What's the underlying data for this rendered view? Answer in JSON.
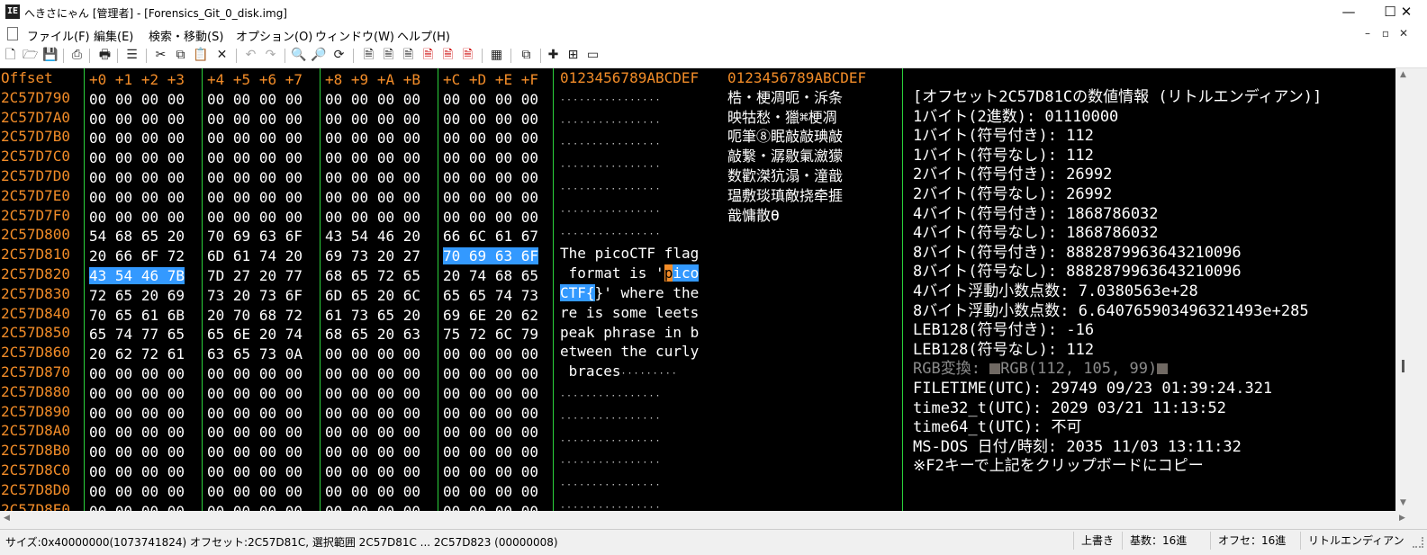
{
  "window": {
    "app_icon_text": "IE",
    "title": "へきさにゃん [管理者] - [Forensics_Git_0_disk.img]",
    "minimize": "—",
    "maximize": "☐",
    "close": "✕"
  },
  "menu": {
    "items": [
      "ファイル(F)",
      "編集(E)",
      "検索・移動(S)",
      "オプション(O)",
      "ウィンドウ(W)",
      "ヘルプ(H)"
    ],
    "mdi_buttons": [
      "–",
      "▫",
      "✕"
    ]
  },
  "toolbar": {
    "icons": [
      "new-file-icon",
      "open-folder-icon",
      "save-icon",
      "print-icon",
      "indent-icon",
      "cut-icon",
      "copy-icon",
      "paste-icon",
      "delete-icon",
      "undo-icon",
      "redo-icon",
      "page-1-icon",
      "page-2-icon",
      "page-3-icon",
      "page-4-icon",
      "page-5-icon",
      "page-6-icon",
      "char-code-icon",
      "window-icon",
      "search-icon",
      "search-next-icon",
      "replace-icon",
      "move-1-icon",
      "move-2-icon",
      "window-layout-icon"
    ]
  },
  "hex_view": {
    "offset_header": "Offset",
    "column_headers": [
      "+0",
      "+1",
      "+2",
      "+3",
      "+4",
      "+5",
      "+6",
      "+7",
      "+8",
      "+9",
      "+A",
      "+B",
      "+C",
      "+D",
      "+E",
      "+F"
    ],
    "ascii_header": "0123456789ABCDEF",
    "sjis_header": "0123456789ABCDEF",
    "rows": [
      {
        "offset": "2C57D790",
        "bytes": [
          "00",
          "00",
          "00",
          "00",
          "00",
          "00",
          "00",
          "00",
          "00",
          "00",
          "00",
          "00",
          "00",
          "00",
          "00",
          "00"
        ],
        "ascii": "................"
      },
      {
        "offset": "2C57D7A0",
        "bytes": [
          "00",
          "00",
          "00",
          "00",
          "00",
          "00",
          "00",
          "00",
          "00",
          "00",
          "00",
          "00",
          "00",
          "00",
          "00",
          "00"
        ],
        "ascii": "................"
      },
      {
        "offset": "2C57D7B0",
        "bytes": [
          "00",
          "00",
          "00",
          "00",
          "00",
          "00",
          "00",
          "00",
          "00",
          "00",
          "00",
          "00",
          "00",
          "00",
          "00",
          "00"
        ],
        "ascii": "................"
      },
      {
        "offset": "2C57D7C0",
        "bytes": [
          "00",
          "00",
          "00",
          "00",
          "00",
          "00",
          "00",
          "00",
          "00",
          "00",
          "00",
          "00",
          "00",
          "00",
          "00",
          "00"
        ],
        "ascii": "................"
      },
      {
        "offset": "2C57D7D0",
        "bytes": [
          "00",
          "00",
          "00",
          "00",
          "00",
          "00",
          "00",
          "00",
          "00",
          "00",
          "00",
          "00",
          "00",
          "00",
          "00",
          "00"
        ],
        "ascii": "................"
      },
      {
        "offset": "2C57D7E0",
        "bytes": [
          "00",
          "00",
          "00",
          "00",
          "00",
          "00",
          "00",
          "00",
          "00",
          "00",
          "00",
          "00",
          "00",
          "00",
          "00",
          "00"
        ],
        "ascii": "................"
      },
      {
        "offset": "2C57D7F0",
        "bytes": [
          "00",
          "00",
          "00",
          "00",
          "00",
          "00",
          "00",
          "00",
          "00",
          "00",
          "00",
          "00",
          "00",
          "00",
          "00",
          "00"
        ],
        "ascii": "................"
      },
      {
        "offset": "2C57D800",
        "bytes": [
          "54",
          "68",
          "65",
          "20",
          "70",
          "69",
          "63",
          "6F",
          "43",
          "54",
          "46",
          "20",
          "66",
          "6C",
          "61",
          "67"
        ],
        "ascii": "The picoCTF flag"
      },
      {
        "offset": "2C57D810",
        "bytes": [
          "20",
          "66",
          "6F",
          "72",
          "6D",
          "61",
          "74",
          "20",
          "69",
          "73",
          "20",
          "27",
          "70",
          "69",
          "63",
          "6F"
        ],
        "ascii": " format is 'pico"
      },
      {
        "offset": "2C57D820",
        "bytes": [
          "43",
          "54",
          "46",
          "7B",
          "7D",
          "27",
          "20",
          "77",
          "68",
          "65",
          "72",
          "65",
          "20",
          "74",
          "68",
          "65"
        ],
        "ascii": "CTF{}' where the"
      },
      {
        "offset": "2C57D830",
        "bytes": [
          "72",
          "65",
          "20",
          "69",
          "73",
          "20",
          "73",
          "6F",
          "6D",
          "65",
          "20",
          "6C",
          "65",
          "65",
          "74",
          "73"
        ],
        "ascii": "re is some leets"
      },
      {
        "offset": "2C57D840",
        "bytes": [
          "70",
          "65",
          "61",
          "6B",
          "20",
          "70",
          "68",
          "72",
          "61",
          "73",
          "65",
          "20",
          "69",
          "6E",
          "20",
          "62"
        ],
        "ascii": "peak phrase in b"
      },
      {
        "offset": "2C57D850",
        "bytes": [
          "65",
          "74",
          "77",
          "65",
          "65",
          "6E",
          "20",
          "74",
          "68",
          "65",
          "20",
          "63",
          "75",
          "72",
          "6C",
          "79"
        ],
        "ascii": "etween the curly"
      },
      {
        "offset": "2C57D860",
        "bytes": [
          "20",
          "62",
          "72",
          "61",
          "63",
          "65",
          "73",
          "0A",
          "00",
          "00",
          "00",
          "00",
          "00",
          "00",
          "00",
          "00"
        ],
        "ascii": " braces........."
      },
      {
        "offset": "2C57D870",
        "bytes": [
          "00",
          "00",
          "00",
          "00",
          "00",
          "00",
          "00",
          "00",
          "00",
          "00",
          "00",
          "00",
          "00",
          "00",
          "00",
          "00"
        ],
        "ascii": "................"
      },
      {
        "offset": "2C57D880",
        "bytes": [
          "00",
          "00",
          "00",
          "00",
          "00",
          "00",
          "00",
          "00",
          "00",
          "00",
          "00",
          "00",
          "00",
          "00",
          "00",
          "00"
        ],
        "ascii": "................"
      },
      {
        "offset": "2C57D890",
        "bytes": [
          "00",
          "00",
          "00",
          "00",
          "00",
          "00",
          "00",
          "00",
          "00",
          "00",
          "00",
          "00",
          "00",
          "00",
          "00",
          "00"
        ],
        "ascii": "................"
      },
      {
        "offset": "2C57D8A0",
        "bytes": [
          "00",
          "00",
          "00",
          "00",
          "00",
          "00",
          "00",
          "00",
          "00",
          "00",
          "00",
          "00",
          "00",
          "00",
          "00",
          "00"
        ],
        "ascii": "................"
      },
      {
        "offset": "2C57D8B0",
        "bytes": [
          "00",
          "00",
          "00",
          "00",
          "00",
          "00",
          "00",
          "00",
          "00",
          "00",
          "00",
          "00",
          "00",
          "00",
          "00",
          "00"
        ],
        "ascii": "................"
      },
      {
        "offset": "2C57D8C0",
        "bytes": [
          "00",
          "00",
          "00",
          "00",
          "00",
          "00",
          "00",
          "00",
          "00",
          "00",
          "00",
          "00",
          "00",
          "00",
          "00",
          "00"
        ],
        "ascii": "................"
      },
      {
        "offset": "2C57D8D0",
        "bytes": [
          "00",
          "00",
          "00",
          "00",
          "00",
          "00",
          "00",
          "00",
          "00",
          "00",
          "00",
          "00",
          "00",
          "00",
          "00",
          "00"
        ],
        "ascii": "................"
      },
      {
        "offset": "2C57D8E0",
        "bytes": [
          "00",
          "00",
          "00",
          "00",
          "00",
          "00",
          "00",
          "00",
          "00",
          "00",
          "00",
          "00",
          "00",
          "00",
          "00",
          "00"
        ],
        "ascii": "................"
      }
    ],
    "sjis_rows": {
      "7": "梏・梗凋呃・泝条",
      "8": "映牯愁・獵⌘梗凋",
      "9": "呃筆⑧眠敲敲琠敲",
      "10": "敲繋・潺敭氭瀲獴",
      "11": "数歡滐犺溻・潼戠",
      "12": "瑥敷琰瑱敵挠牵捱",
      "13": "戠慵散ϴ"
    },
    "selection_start": "2C57D81C",
    "selection_end": "2C57D823",
    "cursor_char": "p"
  },
  "info_panel": {
    "lines": [
      "[オフセット2C57D81Cの数値情報 (リトルエンディアン)]",
      "1バイト(2進数): 01110000",
      "1バイト(符号付き): 112",
      "1バイト(符号なし): 112",
      "2バイト(符号付き): 26992",
      "2バイト(符号なし): 26992",
      "4バイト(符号付き): 1868786032",
      "4バイト(符号なし): 1868786032",
      "8バイト(符号付き): 8882879963643210096",
      "8バイト(符号なし): 8882879963643210096",
      "4バイト浮動小数点数: 7.0380563e+28",
      "8バイト浮動小数点数: 6.640765903496321493e+285",
      "LEB128(符号付き): -16",
      "LEB128(符号なし): 112",
      "FILETIME(UTC): 29749 09/23 01:39:24.321",
      "time32_t(UTC): 2029 03/21 11:13:52",
      "time64_t(UTC): 不可",
      "MS-DOS 日付/時刻: 2035 11/03 13:11:32",
      "",
      "※F2キーで上記をクリップボードにコピー"
    ],
    "rgb_prefix": "RGB変換: ",
    "rgb_value": "RGB(112, 105, 99)",
    "rgb_color": "#706963"
  },
  "statusbar": {
    "main": "サイズ:0x40000000(1073741824) オフセット:2C57D81C, 選択範囲 2C57D81C ... 2C57D823 (00000008)",
    "mode": "上書き",
    "radix": "基数：16進",
    "offset_radix": "オフセ：16進",
    "endian": "リトルエンディアン"
  }
}
